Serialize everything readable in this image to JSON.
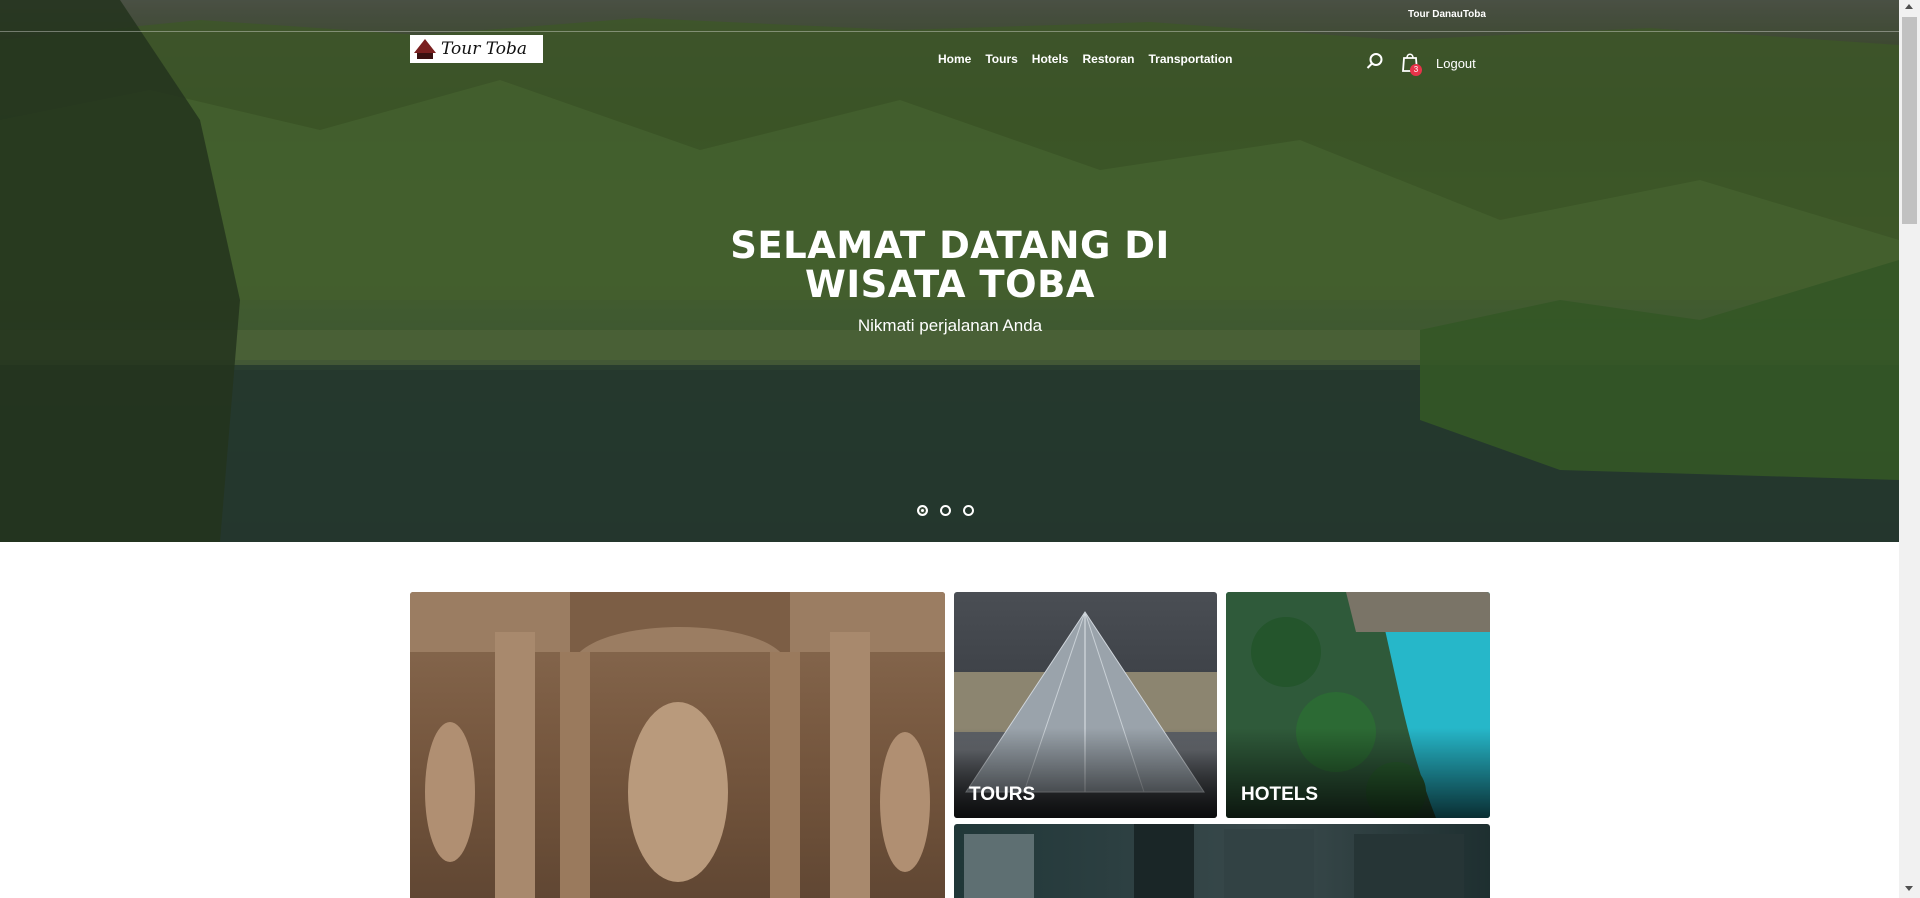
{
  "topbar": {
    "brand": "Tour DanauToba"
  },
  "logo": {
    "text": "Tour Toba"
  },
  "nav": {
    "items": [
      {
        "label": "Home"
      },
      {
        "label": "Tours"
      },
      {
        "label": "Hotels"
      },
      {
        "label": "Restoran"
      },
      {
        "label": "Transportation"
      }
    ]
  },
  "header": {
    "cart_count": "3",
    "logout_label": "Logout"
  },
  "hero": {
    "title_line1": "SELAMAT DATANG DI",
    "title_line2": "WISATA TOBA",
    "subtitle": "Nikmati perjalanan Anda",
    "slide_count": 3,
    "active_slide": 1
  },
  "categories": {
    "tours": "TOURS",
    "hotels": "HOTELS"
  },
  "icons": [
    "search-icon",
    "shopping-bag-icon"
  ],
  "colors": {
    "cart_badge": "#e8334a",
    "nav_text": "#ffffff"
  }
}
